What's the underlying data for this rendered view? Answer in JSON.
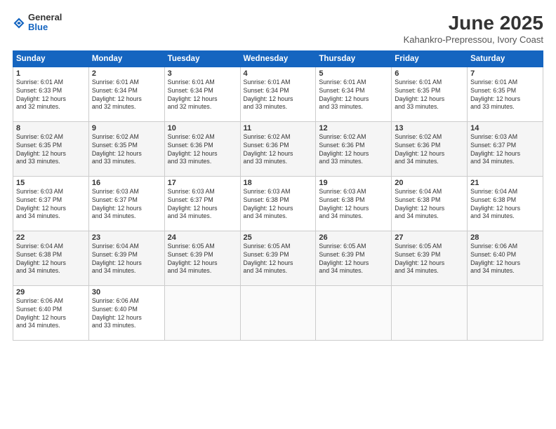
{
  "header": {
    "logo_general": "General",
    "logo_blue": "Blue",
    "month_title": "June 2025",
    "location": "Kahankro-Prepressou, Ivory Coast"
  },
  "weekdays": [
    "Sunday",
    "Monday",
    "Tuesday",
    "Wednesday",
    "Thursday",
    "Friday",
    "Saturday"
  ],
  "weeks": [
    [
      {
        "day": "1",
        "detail": "Sunrise: 6:01 AM\nSunset: 6:33 PM\nDaylight: 12 hours\nand 32 minutes."
      },
      {
        "day": "2",
        "detail": "Sunrise: 6:01 AM\nSunset: 6:34 PM\nDaylight: 12 hours\nand 32 minutes."
      },
      {
        "day": "3",
        "detail": "Sunrise: 6:01 AM\nSunset: 6:34 PM\nDaylight: 12 hours\nand 32 minutes."
      },
      {
        "day": "4",
        "detail": "Sunrise: 6:01 AM\nSunset: 6:34 PM\nDaylight: 12 hours\nand 33 minutes."
      },
      {
        "day": "5",
        "detail": "Sunrise: 6:01 AM\nSunset: 6:34 PM\nDaylight: 12 hours\nand 33 minutes."
      },
      {
        "day": "6",
        "detail": "Sunrise: 6:01 AM\nSunset: 6:35 PM\nDaylight: 12 hours\nand 33 minutes."
      },
      {
        "day": "7",
        "detail": "Sunrise: 6:01 AM\nSunset: 6:35 PM\nDaylight: 12 hours\nand 33 minutes."
      }
    ],
    [
      {
        "day": "8",
        "detail": "Sunrise: 6:02 AM\nSunset: 6:35 PM\nDaylight: 12 hours\nand 33 minutes."
      },
      {
        "day": "9",
        "detail": "Sunrise: 6:02 AM\nSunset: 6:35 PM\nDaylight: 12 hours\nand 33 minutes."
      },
      {
        "day": "10",
        "detail": "Sunrise: 6:02 AM\nSunset: 6:36 PM\nDaylight: 12 hours\nand 33 minutes."
      },
      {
        "day": "11",
        "detail": "Sunrise: 6:02 AM\nSunset: 6:36 PM\nDaylight: 12 hours\nand 33 minutes."
      },
      {
        "day": "12",
        "detail": "Sunrise: 6:02 AM\nSunset: 6:36 PM\nDaylight: 12 hours\nand 33 minutes."
      },
      {
        "day": "13",
        "detail": "Sunrise: 6:02 AM\nSunset: 6:36 PM\nDaylight: 12 hours\nand 34 minutes."
      },
      {
        "day": "14",
        "detail": "Sunrise: 6:03 AM\nSunset: 6:37 PM\nDaylight: 12 hours\nand 34 minutes."
      }
    ],
    [
      {
        "day": "15",
        "detail": "Sunrise: 6:03 AM\nSunset: 6:37 PM\nDaylight: 12 hours\nand 34 minutes."
      },
      {
        "day": "16",
        "detail": "Sunrise: 6:03 AM\nSunset: 6:37 PM\nDaylight: 12 hours\nand 34 minutes."
      },
      {
        "day": "17",
        "detail": "Sunrise: 6:03 AM\nSunset: 6:37 PM\nDaylight: 12 hours\nand 34 minutes."
      },
      {
        "day": "18",
        "detail": "Sunrise: 6:03 AM\nSunset: 6:38 PM\nDaylight: 12 hours\nand 34 minutes."
      },
      {
        "day": "19",
        "detail": "Sunrise: 6:03 AM\nSunset: 6:38 PM\nDaylight: 12 hours\nand 34 minutes."
      },
      {
        "day": "20",
        "detail": "Sunrise: 6:04 AM\nSunset: 6:38 PM\nDaylight: 12 hours\nand 34 minutes."
      },
      {
        "day": "21",
        "detail": "Sunrise: 6:04 AM\nSunset: 6:38 PM\nDaylight: 12 hours\nand 34 minutes."
      }
    ],
    [
      {
        "day": "22",
        "detail": "Sunrise: 6:04 AM\nSunset: 6:38 PM\nDaylight: 12 hours\nand 34 minutes."
      },
      {
        "day": "23",
        "detail": "Sunrise: 6:04 AM\nSunset: 6:39 PM\nDaylight: 12 hours\nand 34 minutes."
      },
      {
        "day": "24",
        "detail": "Sunrise: 6:05 AM\nSunset: 6:39 PM\nDaylight: 12 hours\nand 34 minutes."
      },
      {
        "day": "25",
        "detail": "Sunrise: 6:05 AM\nSunset: 6:39 PM\nDaylight: 12 hours\nand 34 minutes."
      },
      {
        "day": "26",
        "detail": "Sunrise: 6:05 AM\nSunset: 6:39 PM\nDaylight: 12 hours\nand 34 minutes."
      },
      {
        "day": "27",
        "detail": "Sunrise: 6:05 AM\nSunset: 6:39 PM\nDaylight: 12 hours\nand 34 minutes."
      },
      {
        "day": "28",
        "detail": "Sunrise: 6:06 AM\nSunset: 6:40 PM\nDaylight: 12 hours\nand 34 minutes."
      }
    ],
    [
      {
        "day": "29",
        "detail": "Sunrise: 6:06 AM\nSunset: 6:40 PM\nDaylight: 12 hours\nand 34 minutes."
      },
      {
        "day": "30",
        "detail": "Sunrise: 6:06 AM\nSunset: 6:40 PM\nDaylight: 12 hours\nand 33 minutes."
      },
      null,
      null,
      null,
      null,
      null
    ]
  ]
}
